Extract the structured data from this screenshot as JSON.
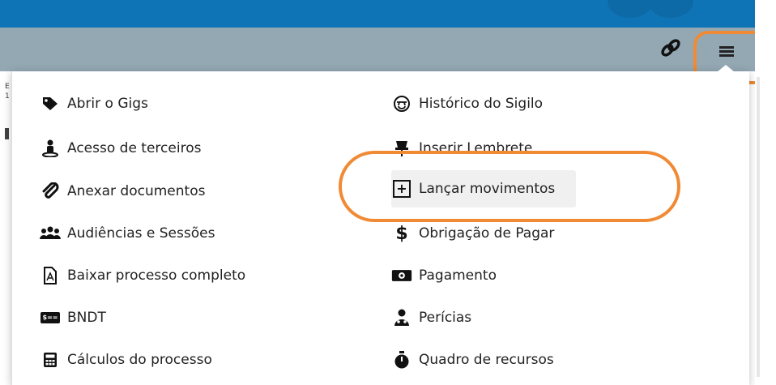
{
  "menu": {
    "left": [
      {
        "label": "Abrir o Gigs",
        "icon": "tag-icon"
      },
      {
        "label": "Acesso de terceiros",
        "icon": "user-pin-icon"
      },
      {
        "label": "Anexar documentos",
        "icon": "paperclip-icon"
      },
      {
        "label": "Audiências e Sessões",
        "icon": "users-icon"
      },
      {
        "label": "Baixar processo completo",
        "icon": "pdf-file-icon"
      },
      {
        "label": "BNDT",
        "icon": "money-card-icon"
      },
      {
        "label": "Cálculos do processo",
        "icon": "calculator-icon"
      }
    ],
    "right": [
      {
        "label": "Histórico do Sigilo",
        "icon": "user-secret-icon"
      },
      {
        "label": "Inserir Lembrete",
        "icon": "thumbtack-icon"
      },
      {
        "label": "Lançar movimentos",
        "icon": "plus-square-icon"
      },
      {
        "label": "Obrigação de Pagar",
        "icon": "dollar-icon"
      },
      {
        "label": "Pagamento",
        "icon": "money-bill-icon"
      },
      {
        "label": "Perícias",
        "icon": "user-doctor-icon"
      },
      {
        "label": "Quadro de recursos",
        "icon": "stopwatch-icon"
      }
    ]
  },
  "glyphs": {
    "dollar": "$",
    "badge": "$=="
  },
  "colors": {
    "topbar": "#0f74b5",
    "toolbar": "#94a8b4",
    "highlight": "#f08a35",
    "menu_bg": "#ffffff"
  }
}
